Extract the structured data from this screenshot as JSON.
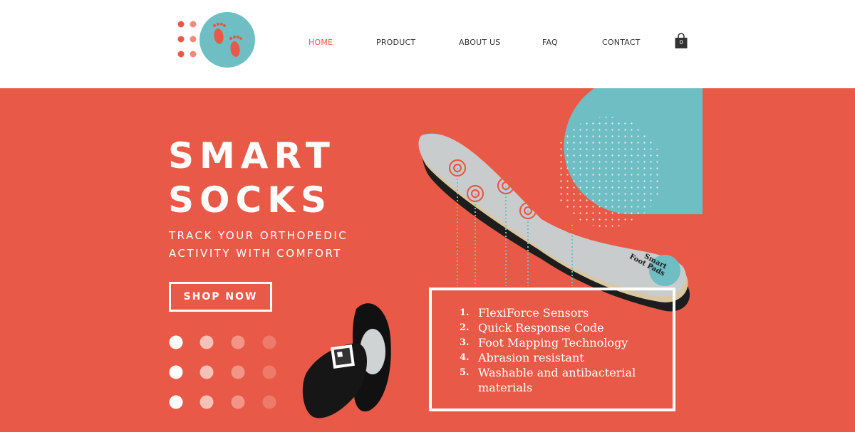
{
  "nav": {
    "items": [
      {
        "label": "HOME",
        "active": true
      },
      {
        "label": "PRODUCT",
        "active": false
      },
      {
        "label": "ABOUT US",
        "active": false
      },
      {
        "label": "FAQ",
        "active": false
      },
      {
        "label": "CONTACT",
        "active": false
      }
    ],
    "cart_count": "0"
  },
  "hero": {
    "title_line1": "SMART",
    "title_line2": "SOCKS",
    "tagline_line1": "TRACK YOUR ORTHOPEDIC",
    "tagline_line2": "ACTIVITY WITH COMFORT",
    "cta_label": "SHOP NOW",
    "insole_text_line1": "Smart",
    "insole_text_line2": "Foot Pads"
  },
  "features": [
    {
      "num": "1.",
      "text": "FlexiForce Sensors"
    },
    {
      "num": "2.",
      "text": "Quick Response Code"
    },
    {
      "num": "3.",
      "text": "Foot Mapping Technology"
    },
    {
      "num": "4.",
      "text": "Abrasion resistant"
    },
    {
      "num": "5.",
      "text": "Washable and antibacterial materials"
    }
  ],
  "colors": {
    "brand_red": "#e85a47",
    "teal": "#6fbec3",
    "white": "#ffffff",
    "nav_text": "#333333"
  },
  "icons": [
    "footprints-logo-icon",
    "shopping-bag-icon"
  ]
}
